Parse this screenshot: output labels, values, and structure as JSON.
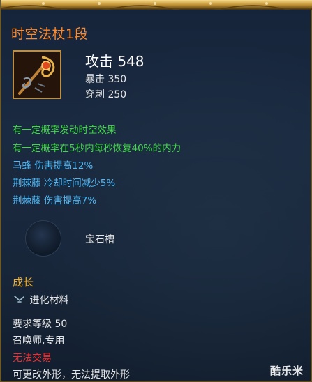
{
  "item": {
    "name": "时空法杖1段",
    "icon": "staff-weapon-icon",
    "attack_label": "攻击 548",
    "stats": [
      "暴击 350",
      "穿刺 250"
    ]
  },
  "effects": [
    {
      "text": "有一定概率发动时空效果",
      "color": "#44d94a"
    },
    {
      "text": "有一定概率在5秒内每秒恢复40%的内力",
      "color": "#44d94a"
    },
    {
      "text": "马蜂 伤害提高12%",
      "color": "#4fb8f5"
    },
    {
      "text": "荆棘藤 冷却时间减少5%",
      "color": "#4fb8f5"
    },
    {
      "text": "荆棘藤 伤害提高7%",
      "color": "#4fb8f5"
    }
  ],
  "gem": {
    "label": "宝石槽",
    "icon": "gem-slot-icon"
  },
  "growth": {
    "title": "成长",
    "material_label": "进化材料",
    "material_icon": "wrench-icon"
  },
  "requirements": {
    "level": "要求等级 50",
    "class": "召唤师,专用"
  },
  "trade": {
    "status": "无法交易",
    "color": "#ff2a2a"
  },
  "note": "可更改外形，无法提取外形",
  "watermark": "酷乐米",
  "colors": {
    "title": "#ff8a2a",
    "section": "#f0b030",
    "border": "#c89a3a"
  }
}
